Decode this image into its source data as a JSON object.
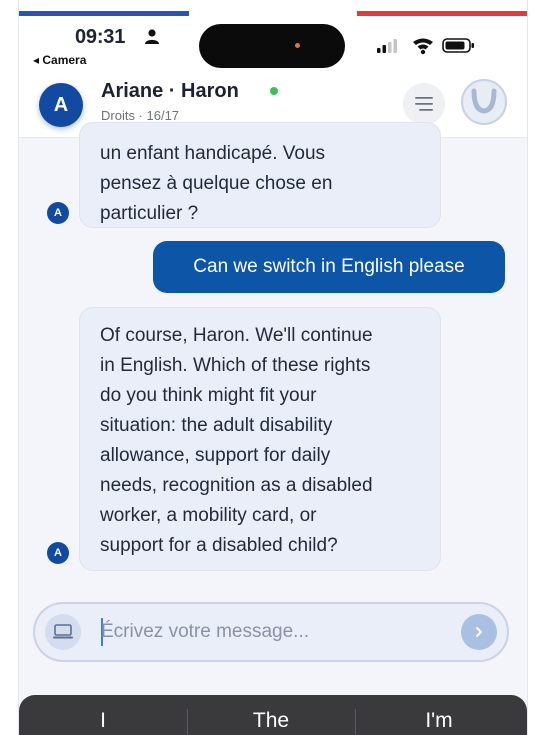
{
  "status_bar": {
    "time": "09:31",
    "back_label": "◂ Camera"
  },
  "header": {
    "avatar_letter": "A",
    "contact_name": "Ariane · Haron",
    "subtitle": "Droits · 16/17",
    "online_color": "#3fbf5c"
  },
  "messages": [
    {
      "from": "assistant",
      "avatar": "A",
      "lines": [
        "un enfant handicapé. Vous",
        "pensez à quelque chose en",
        "particulier ?"
      ]
    },
    {
      "from": "user",
      "text": "Can we switch in English please"
    },
    {
      "from": "assistant",
      "avatar": "A",
      "lines": [
        "Of course, Haron. We'll continue",
        "in English. Which of these rights",
        "do you think might fit your",
        "situation: the adult disability",
        "allowance, support for daily",
        "needs, recognition as a disabled",
        "worker, a mobility card, or",
        "support for a disabled child?"
      ]
    }
  ],
  "composer": {
    "placeholder": "Écrivez votre message..."
  },
  "keyboard_suggestions": [
    "I",
    "The",
    "I'm"
  ],
  "colors": {
    "accent": "#114aa0",
    "user_bubble": "#0d55a6",
    "assistant_bubble": "#e9eef8"
  }
}
